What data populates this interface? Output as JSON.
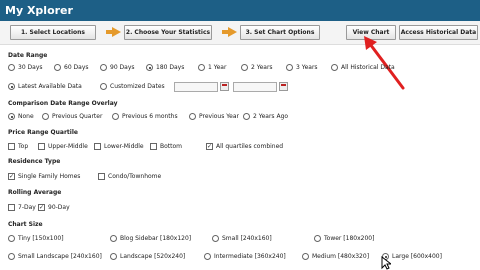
{
  "app": {
    "title": "My Xplorer"
  },
  "steps": {
    "step1": "1. Select Locations",
    "step2": "2. Choose Your Statistics",
    "step3": "3. Set Chart Options",
    "view_chart": "View Chart",
    "historical": "Access Historical Data"
  },
  "date_range": {
    "label": "Date Range",
    "options": [
      "30 Days",
      "60 Days",
      "90 Days",
      "180 Days",
      "1 Year",
      "2 Years",
      "3 Years",
      "All Historical Data"
    ],
    "selected": "180 Days",
    "latest": "Latest Available Data",
    "customized": "Customized Dates"
  },
  "comparison": {
    "label": "Comparison Date Range Overlay",
    "options": [
      "None",
      "Previous Quarter",
      "Previous 6 months",
      "Previous Year",
      "2 Years Ago"
    ],
    "selected": "None"
  },
  "quartile": {
    "label": "Price Range Quartile",
    "options": [
      "Top",
      "Upper-Middle",
      "Lower-Middle",
      "Bottom",
      "All quartiles combined"
    ],
    "checked": "All quartiles combined"
  },
  "residence": {
    "label": "Residence Type",
    "options": [
      "Single Family Homes",
      "Condo/Townhome"
    ],
    "checked": "Single Family Homes"
  },
  "rolling": {
    "label": "Rolling Average",
    "options": [
      "7-Day",
      "90-Day"
    ],
    "checked": "90-Day"
  },
  "chart_size": {
    "label": "Chart Size",
    "row1": [
      "Tiny [150x100]",
      "Blog Sidebar [180x120]",
      "Small [240x160]",
      "Tower [180x200]"
    ],
    "row2": [
      "Small Landscape [240x160]",
      "Landscape [520x240]",
      "Intermediate [360x240]",
      "Medium [480x320]",
      "Large [600x400]"
    ],
    "selected": "Large [600x400]"
  },
  "colors": {
    "header": "#1d5f86",
    "arrow": "#e59a2c",
    "annotation": "#e02020"
  }
}
